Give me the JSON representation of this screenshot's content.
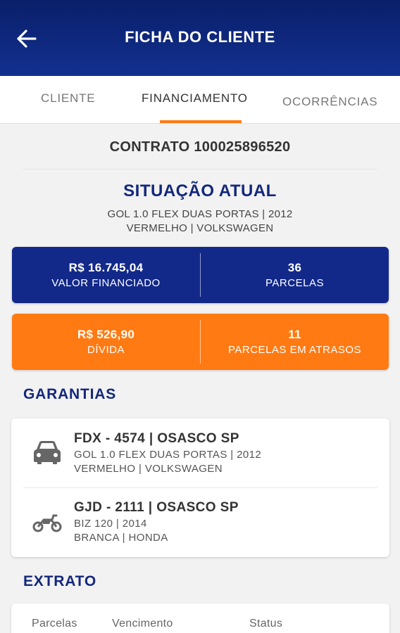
{
  "header": {
    "title": "FICHA DO CLIENTE",
    "back_icon": "arrow-left-icon"
  },
  "tabs": [
    {
      "label": "CLIENTE",
      "active": false
    },
    {
      "label": "FINANCIAMENTO",
      "active": true
    },
    {
      "label": "OCORRÊNCIAS",
      "active": false
    }
  ],
  "contract": {
    "label": "CONTRATO 100025896520"
  },
  "situacao": {
    "title": "SITUAÇÃO ATUAL",
    "line1": "GOL 1.0 FLEX DUAS PORTAS | 2012",
    "line2": "VERMELHO | VOLKSWAGEN"
  },
  "summary_blue": {
    "left_value": "R$ 16.745,04",
    "left_label": "VALOR FINANCIADO",
    "right_value": "36",
    "right_label": "PARCELAS"
  },
  "summary_orange": {
    "left_value": "R$ 526,90",
    "left_label": "DÍVIDA",
    "right_value": "11",
    "right_label": "PARCELAS EM ATRASOS"
  },
  "garantias": {
    "title": "GARANTIAS",
    "items": [
      {
        "icon": "car-icon",
        "title": "FDX - 4574 | OSASCO SP",
        "line1": "GOL 1.0 FLEX DUAS PORTAS | 2012",
        "line2": "VERMELHO | VOLKSWAGEN"
      },
      {
        "icon": "motorcycle-icon",
        "title": "GJD - 2111 | OSASCO SP",
        "line1": "BIZ 120 | 2014",
        "line2": "BRANCA | HONDA"
      }
    ]
  },
  "extrato": {
    "title": "EXTRATO",
    "columns": [
      "Parcelas",
      "Vencimento",
      "Status"
    ]
  },
  "colors": {
    "brand_blue": "#12298a",
    "accent_orange": "#ff7a12",
    "title_blue": "#13287b"
  }
}
